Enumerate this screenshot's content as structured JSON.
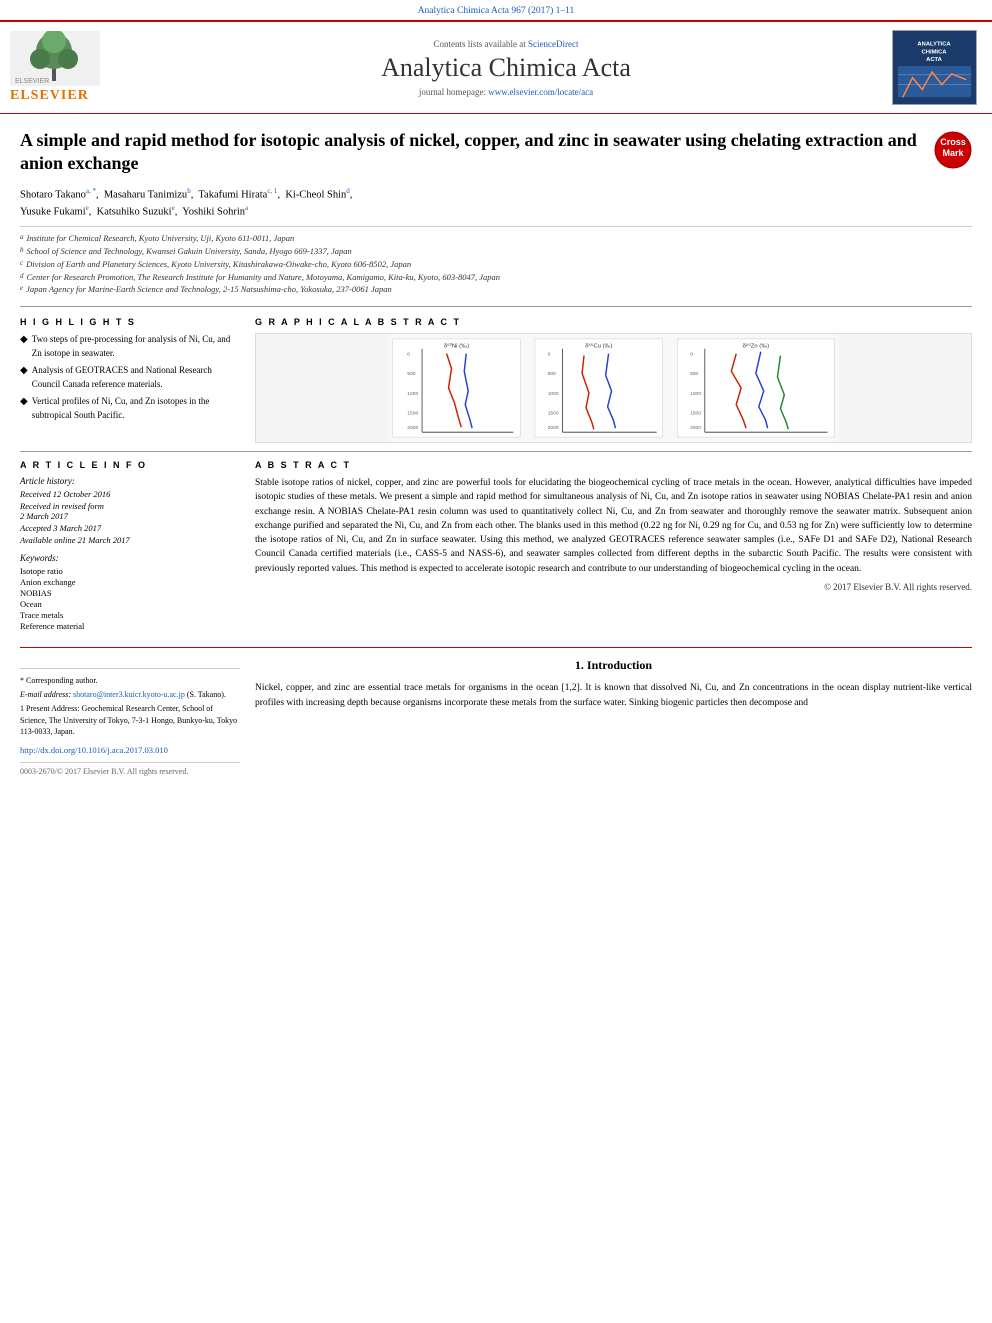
{
  "topBar": {
    "journalRef": "Analytica Chimica Acta 967 (2017) 1–11"
  },
  "header": {
    "sciencedirect": "Contents lists available at ScienceDirect",
    "journalTitle": "Analytica Chimica Acta",
    "homepage": "journal homepage: www.elsevier.com/locate/aca"
  },
  "article": {
    "title": "A simple and rapid method for isotopic analysis of nickel, copper, and zinc in seawater using chelating extraction and anion exchange",
    "authors": [
      {
        "name": "Shotaro Takano",
        "sups": "a, *"
      },
      {
        "name": "Masaharu Tanimizu",
        "sups": "b"
      },
      {
        "name": "Takafumi Hirata",
        "sups": "c, 1"
      },
      {
        "name": "Ki-Cheol Shin",
        "sups": "d"
      },
      {
        "name": "Yusuke Fukami",
        "sups": "e"
      },
      {
        "name": "Katsuhiko Suzuki",
        "sups": "e"
      },
      {
        "name": "Yoshiki Sohrin",
        "sups": "a"
      }
    ],
    "affiliations": [
      {
        "sup": "a",
        "text": "Institute for Chemical Research, Kyoto University, Uji, Kyoto 611-0011, Japan"
      },
      {
        "sup": "b",
        "text": "School of Science and Technology, Kwansei Gakuin University, Sanda, Hyogo 669-1337, Japan"
      },
      {
        "sup": "c",
        "text": "Division of Earth and Planetary Sciences, Kyoto University, Kitashirakawa-Oiwake-cho, Kyoto 606-8502, Japan"
      },
      {
        "sup": "d",
        "text": "Center for Research Promotion, The Research Institute for Humanity and Nature, Motoyama, Kamigamo, Kita-ku, Kyoto, 603-8047, Japan"
      },
      {
        "sup": "e",
        "text": "Japan Agency for Marine-Earth Science and Technology, 2-15 Natsushima-cho, Yokosuka, 237-0061 Japan"
      }
    ]
  },
  "highlights": {
    "sectionTitle": "H I G H L I G H T S",
    "items": [
      "Two steps of pre-processing for analysis of Ni, Cu, and Zn isotope in seawater.",
      "Analysis of GEOTRACES and National Research Council Canada reference materials.",
      "Vertical profiles of Ni, Cu, and Zn isotopes in the subtropical South Pacific."
    ]
  },
  "graphicalAbstract": {
    "sectionTitle": "G R A P H I C A L   A B S T R A C T"
  },
  "articleInfo": {
    "sectionTitle": "A R T I C L E   I N F O",
    "historyTitle": "Article history:",
    "history": [
      {
        "label": "Received",
        "date": "12 October 2016"
      },
      {
        "label": "Received in revised form",
        "date": "2 March 2017"
      },
      {
        "label": "Accepted",
        "date": "3 March 2017"
      },
      {
        "label": "Available online",
        "date": "21 March 2017"
      }
    ],
    "keywordsTitle": "Keywords:",
    "keywords": [
      "Isotope ratio",
      "Anion exchange",
      "NOBIAS",
      "Ocean",
      "Trace metals",
      "Reference material"
    ]
  },
  "abstract": {
    "sectionTitle": "A B S T R A C T",
    "text": "Stable isotope ratios of nickel, copper, and zinc are powerful tools for elucidating the biogeochemical cycling of trace metals in the ocean. However, analytical difficulties have impeded isotopic studies of these metals. We present a simple and rapid method for simultaneous analysis of Ni, Cu, and Zn isotope ratios in seawater using NOBIAS Chelate-PA1 resin and anion exchange resin. A NOBIAS Chelate-PA1 resin column was used to quantitatively collect Ni, Cu, and Zn from seawater and thoroughly remove the seawater matrix. Subsequent anion exchange purified and separated the Ni, Cu, and Zn from each other. The blanks used in this method (0.22 ng for Ni, 0.29 ng for Cu, and 0.53 ng for Zn) were sufficiently low to determine the isotope ratios of Ni, Cu, and Zn in surface seawater. Using this method, we analyzed GEOTRACES reference seawater samples (i.e., SAFe D1 and SAFe D2), National Research Council Canada certified materials (i.e., CASS-5 and NASS-6), and seawater samples collected from different depths in the subarctic South Pacific. The results were consistent with previously reported values. This method is expected to accelerate isotopic research and contribute to our understanding of biogeochemical cycling in the ocean.",
    "copyright": "© 2017 Elsevier B.V. All rights reserved."
  },
  "introduction": {
    "sectionNumber": "1.",
    "sectionTitle": "Introduction",
    "text": "Nickel, copper, and zinc are essential trace metals for organisms in the ocean [1,2]. It is known that dissolved Ni, Cu, and Zn concentrations in the ocean display nutrient-like vertical profiles with increasing depth because organisms incorporate these metals from the surface water. Sinking biogenic particles then decompose and"
  },
  "footnotes": {
    "corresponding": "* Corresponding author.",
    "email": "E-mail address: shotaro@inter3.kuicr.kyoto-u.ac.jp (S. Takano).",
    "presentAddress": "1 Present Address: Geochemical Research Center, School of Science, The University of Tokyo, 7-3-1 Hongo, Bunkyo-ku, Tokyo 113-0033, Japan.",
    "doi": "http://dx.doi.org/10.1016/j.aca.2017.03.010",
    "issn": "0003-2670/© 2017 Elsevier B.V. All rights reserved."
  }
}
